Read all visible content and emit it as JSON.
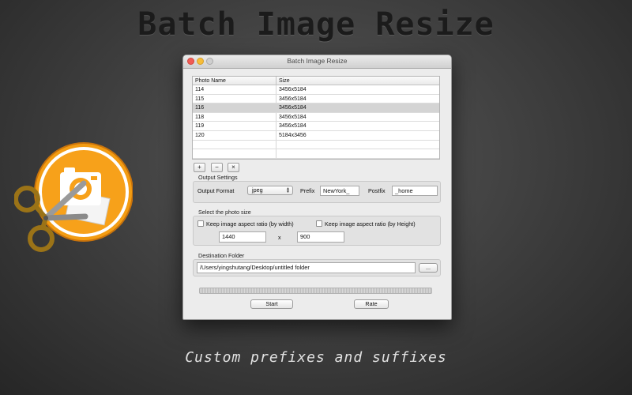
{
  "headline": "Batch Image Resize",
  "caption": "Custom prefixes and suffixes",
  "window": {
    "title": "Batch Image Resize",
    "table": {
      "columns": [
        "Photo Name",
        "Size"
      ],
      "rows": [
        {
          "name": "114",
          "size": "3456x5184"
        },
        {
          "name": "115",
          "size": "3456x5184"
        },
        {
          "name": "116",
          "size": "3456x5184",
          "selected": true
        },
        {
          "name": "118",
          "size": "3456x5184"
        },
        {
          "name": "119",
          "size": "3456x5184"
        },
        {
          "name": "120",
          "size": "5184x3456"
        }
      ]
    },
    "list_buttons": {
      "add": "+",
      "remove": "−",
      "clear": "×"
    },
    "output_settings": {
      "group_label": "Output Settings",
      "format_label": "Output Format",
      "format_value": "jpeg",
      "prefix_label": "Prefix",
      "prefix_value": "NewYork_",
      "postfix_label": "Postfix",
      "postfix_value": "_home"
    },
    "photo_size": {
      "group_label": "Select the photo size",
      "keep_width_label": "Keep image aspect ratio (by width)",
      "keep_height_label": "Keep image aspect ratio (by Height)",
      "keep_width_checked": false,
      "keep_height_checked": false,
      "width_value": "1440",
      "times": "x",
      "height_value": "900"
    },
    "destination": {
      "group_label": "Destination Folder",
      "path": "/Users/yingshutang/Desktop/untitled folder",
      "browse_label": "..."
    },
    "start_label": "Start",
    "rate_label": "Rate"
  },
  "colors": {
    "icon_ring": "#f39c12",
    "icon_inner": "#f7a11a",
    "selection": "#d4d4d4",
    "window_bg": "#ececec"
  },
  "icons": [
    "camera-icon",
    "scissors-icon",
    "close-icon",
    "minimize-icon",
    "zoom-icon"
  ]
}
